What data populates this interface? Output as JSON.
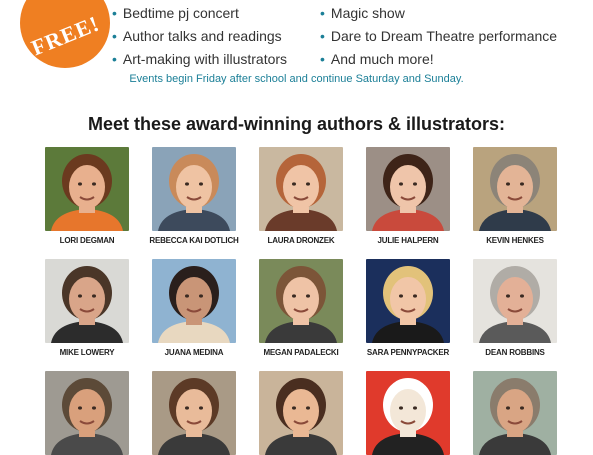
{
  "badge": {
    "text": "FREE!",
    "color": "#ef7f22"
  },
  "events": {
    "left": [
      "Bedtime pj concert",
      "Author talks and readings",
      "Art-making with illustrators"
    ],
    "right": [
      "Magic show",
      "Dare to Dream Theatre performance",
      "And much more!"
    ]
  },
  "note": "Events begin Friday after school and continue Saturday and Sunday.",
  "heading": "Meet these award-winning authors & illustrators:",
  "people": [
    {
      "name": "LORI DEGMAN",
      "bg": "#5c7a3a",
      "hair": "#6b3a1f",
      "skin": "#e8b08e",
      "shirt": "#e7762c"
    },
    {
      "name": "REBECCA KAI DOTLICH",
      "bg": "#8aa3b8",
      "hair": "#c98a5a",
      "skin": "#efc3a3",
      "shirt": "#3d4a5c"
    },
    {
      "name": "LAURA DRONZEK",
      "bg": "#c9b8a0",
      "hair": "#b5653a",
      "skin": "#f0c4a6",
      "shirt": "#6a3b2a"
    },
    {
      "name": "JULIE HALPERN",
      "bg": "#9c8f86",
      "hair": "#3e2418",
      "skin": "#efc5aa",
      "shirt": "#c94a3c"
    },
    {
      "name": "KEVIN HENKES",
      "bg": "#b9a37e",
      "hair": "#8c8478",
      "skin": "#e3b496",
      "shirt": "#2f3b4a"
    },
    {
      "name": "MIKE LOWERY",
      "bg": "#d9d9d5",
      "hair": "#4a3628",
      "skin": "#d9a589",
      "shirt": "#2c2c2c"
    },
    {
      "name": "JUANA MEDINA",
      "bg": "#8fb3d1",
      "hair": "#2a1f1c",
      "skin": "#c99577",
      "shirt": "#e8d8c0"
    },
    {
      "name": "MEGAN PADALECKI",
      "bg": "#7a8a5a",
      "hair": "#7c5538",
      "skin": "#efc3a6",
      "shirt": "#3a3a3a"
    },
    {
      "name": "SARA PENNYPACKER",
      "bg": "#1b2f5c",
      "hair": "#e2c27a",
      "skin": "#f1c6a7",
      "shirt": "#1a1a1a"
    },
    {
      "name": "DEAN ROBBINS",
      "bg": "#e5e3de",
      "hair": "#b0aca6",
      "skin": "#e3b097",
      "shirt": "#5a5a5a"
    },
    {
      "name": "",
      "bg": "#9e9a92",
      "hair": "#5c4a38",
      "skin": "#d9a07c",
      "shirt": "#4a4a4a"
    },
    {
      "name": "",
      "bg": "#a99a86",
      "hair": "#5c3a26",
      "skin": "#e9bb9a",
      "shirt": "#3a3a3a"
    },
    {
      "name": "",
      "bg": "#c9b49a",
      "hair": "#4a2e20",
      "skin": "#eab894",
      "shirt": "#3a3a3a"
    },
    {
      "name": "",
      "bg": "#e03a2c",
      "hair": "#ffffff",
      "skin": "#f3e7d8",
      "shirt": "#222222"
    },
    {
      "name": "",
      "bg": "#9fb0a2",
      "hair": "#8a7c6c",
      "skin": "#d9a584",
      "shirt": "#3a3a3a"
    }
  ]
}
